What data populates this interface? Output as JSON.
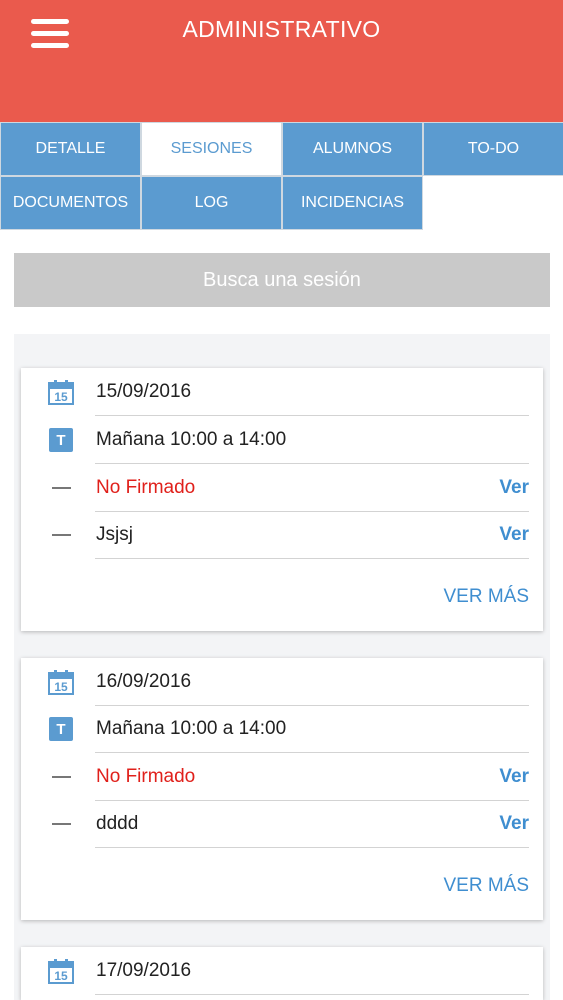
{
  "header": {
    "title": "ADMINISTRATIVO"
  },
  "tabs": [
    {
      "label": "DETALLE",
      "active": false
    },
    {
      "label": "SESIONES",
      "active": true
    },
    {
      "label": "ALUMNOS",
      "active": false
    },
    {
      "label": "TO-DO",
      "active": false
    },
    {
      "label": "DOCUMENTOS",
      "active": false
    },
    {
      "label": "LOG",
      "active": false
    },
    {
      "label": "INCIDENCIAS",
      "active": false
    }
  ],
  "search": {
    "label": "Busca una sesión"
  },
  "sessions": [
    {
      "date": "15/09/2016",
      "calendar_day": "15",
      "turn_letter": "T",
      "time": "Mañana 10:00 a 14:00",
      "status": "No Firmado",
      "status_action": "Ver",
      "note": "Jsjsj",
      "note_action": "Ver",
      "more": "VER MÁS"
    },
    {
      "date": "16/09/2016",
      "calendar_day": "15",
      "turn_letter": "T",
      "time": "Mañana 10:00 a 14:00",
      "status": "No Firmado",
      "status_action": "Ver",
      "note": "dddd",
      "note_action": "Ver",
      "more": "VER MÁS"
    },
    {
      "date": "17/09/2016",
      "calendar_day": "15"
    }
  ],
  "colors": {
    "header": "#ea5a4d",
    "tab": "#5b9bd0",
    "link": "#3f8ed0",
    "status_red": "#e0201b"
  },
  "icons": {
    "menu": "hamburger-icon",
    "date": "calendar-icon",
    "turn": "turn-t-icon",
    "row": "dash-icon"
  }
}
